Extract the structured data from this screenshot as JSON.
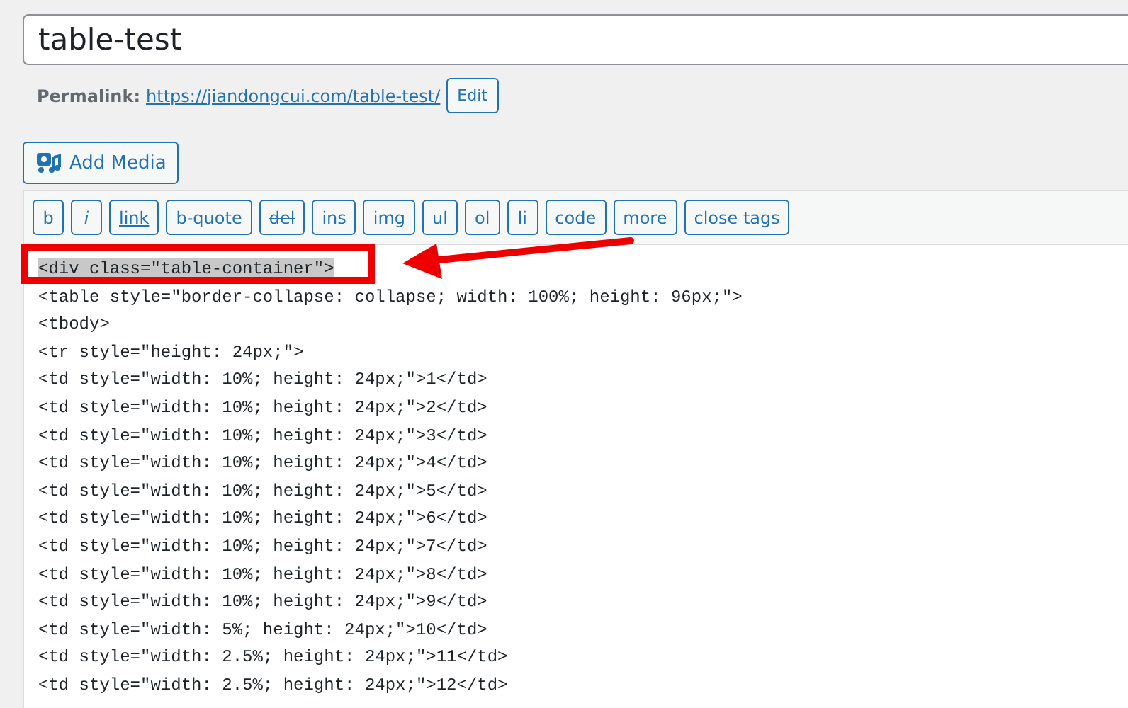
{
  "title_field": {
    "value": "table-test"
  },
  "permalink": {
    "label": "Permalink:",
    "url": "https://jiandongcui.com/table-test/",
    "edit_button": "Edit"
  },
  "add_media_button": "Add Media",
  "toolbar": [
    {
      "label": "b",
      "kind": "plain"
    },
    {
      "label": "i",
      "kind": "italic"
    },
    {
      "label": "link",
      "kind": "underline"
    },
    {
      "label": "b-quote",
      "kind": "plain"
    },
    {
      "label": "del",
      "kind": "strike"
    },
    {
      "label": "ins",
      "kind": "plain"
    },
    {
      "label": "img",
      "kind": "plain"
    },
    {
      "label": "ul",
      "kind": "plain"
    },
    {
      "label": "ol",
      "kind": "plain"
    },
    {
      "label": "li",
      "kind": "plain"
    },
    {
      "label": "code",
      "kind": "plain"
    },
    {
      "label": "more",
      "kind": "plain"
    },
    {
      "label": "close tags",
      "kind": "plain"
    }
  ],
  "code_lines": [
    {
      "text": "<div class=\"table-container\">",
      "highlighted": true
    },
    {
      "text": "<table style=\"border-collapse: collapse; width: 100%; height: 96px;\">",
      "highlighted": false
    },
    {
      "text": "<tbody>",
      "highlighted": false
    },
    {
      "text": "<tr style=\"height: 24px;\">",
      "highlighted": false
    },
    {
      "text": "<td style=\"width: 10%; height: 24px;\">1</td>",
      "highlighted": false
    },
    {
      "text": "<td style=\"width: 10%; height: 24px;\">2</td>",
      "highlighted": false
    },
    {
      "text": "<td style=\"width: 10%; height: 24px;\">3</td>",
      "highlighted": false
    },
    {
      "text": "<td style=\"width: 10%; height: 24px;\">4</td>",
      "highlighted": false
    },
    {
      "text": "<td style=\"width: 10%; height: 24px;\">5</td>",
      "highlighted": false
    },
    {
      "text": "<td style=\"width: 10%; height: 24px;\">6</td>",
      "highlighted": false
    },
    {
      "text": "<td style=\"width: 10%; height: 24px;\">7</td>",
      "highlighted": false
    },
    {
      "text": "<td style=\"width: 10%; height: 24px;\">8</td>",
      "highlighted": false
    },
    {
      "text": "<td style=\"width: 10%; height: 24px;\">9</td>",
      "highlighted": false
    },
    {
      "text": "<td style=\"width: 5%; height: 24px;\">10</td>",
      "highlighted": false
    },
    {
      "text": "<td style=\"width: 2.5%; height: 24px;\">11</td>",
      "highlighted": false
    },
    {
      "text": "<td style=\"width: 2.5%; height: 24px;\">12</td>",
      "highlighted": false
    }
  ]
}
